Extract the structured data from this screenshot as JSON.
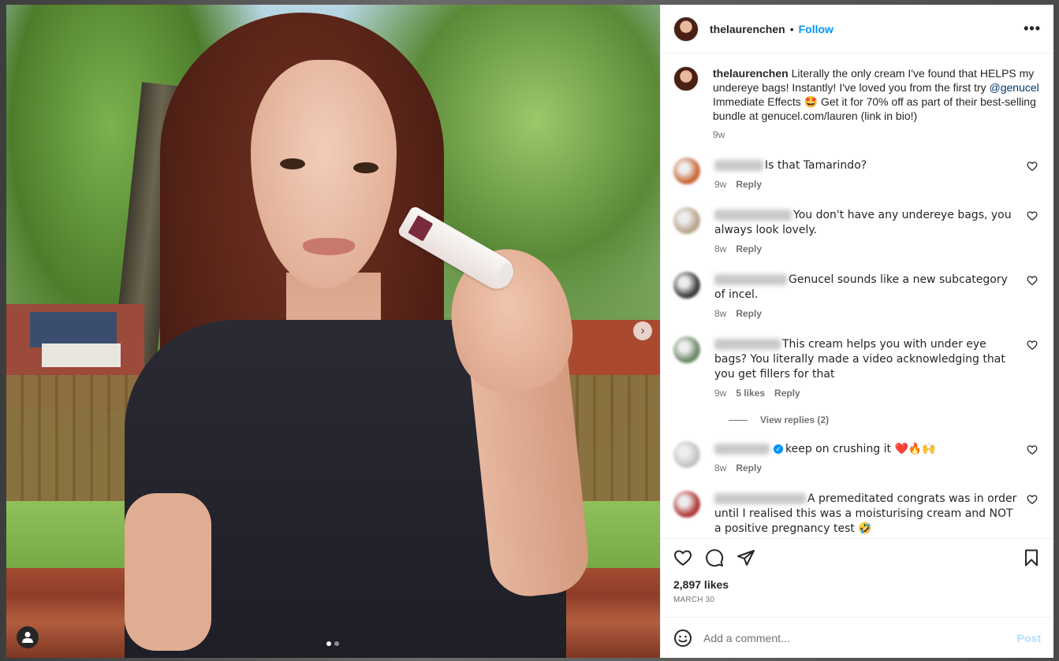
{
  "post": {
    "username": "thelaurenchen",
    "separator": "•",
    "follow_label": "Follow",
    "more_label": "•••",
    "caption": {
      "username": "thelaurenchen",
      "text_1": " Literally the only cream I've found that HELPS my undereye bags! Instantly! I've loved you from the first try ",
      "mention": "@genucel",
      "text_2": " Immediate Effects 🤩 Get it for 70% off as part of their best-selling bundle at genucel.com/lauren (link in bio!)",
      "time": "9w"
    },
    "comments": [
      {
        "text": "Is that Tamarindo?",
        "time": "9w",
        "likes": "",
        "reply": "Reply",
        "avatar_color": "#c96a3a",
        "name_width": 62
      },
      {
        "text": "You don't have any undereye bags, you always look lovely.",
        "time": "8w",
        "likes": "",
        "reply": "Reply",
        "avatar_color": "#b9a58c",
        "name_width": 98
      },
      {
        "text": "Genucel sounds like a new subcategory of incel.",
        "time": "8w",
        "likes": "",
        "reply": "Reply",
        "avatar_color": "#3c3c3c",
        "name_width": 92
      },
      {
        "text": "This cream helps you with under eye bags? You literally made a video acknowledging that you get fillers for that",
        "time": "9w",
        "likes": "5 likes",
        "reply": "Reply",
        "avatar_color": "#6f8a6a",
        "name_width": 84
      },
      {
        "text": "keep on crushing it ❤️🔥🙌",
        "time": "8w",
        "likes": "",
        "reply": "Reply",
        "avatar_color": "#c4c4c4",
        "name_width": 70,
        "verified": true
      },
      {
        "text": "A premeditated congrats was in order until I realised this was a moisturising cream and NOT a positive pregnancy test 🤣",
        "time": "",
        "likes": "",
        "reply": "",
        "avatar_color": "#b23a3a",
        "name_width": 116
      }
    ],
    "view_replies": "View replies (2)",
    "likes": "2,897 likes",
    "date": "MARCH 30",
    "comment_placeholder": "Add a comment...",
    "post_label": "Post",
    "next_arrow": "›",
    "carousel": {
      "count": 2,
      "active": 0
    }
  },
  "icons": {
    "heart": "heart-icon",
    "comment": "comment-icon",
    "share": "share-icon",
    "save": "bookmark-icon",
    "emoji": "emoji-icon",
    "tag": "user-tag-icon"
  },
  "colors": {
    "accent": "#0095f6",
    "mention": "#00376b",
    "muted": "#737373",
    "post_disabled": "#b2dffc"
  }
}
